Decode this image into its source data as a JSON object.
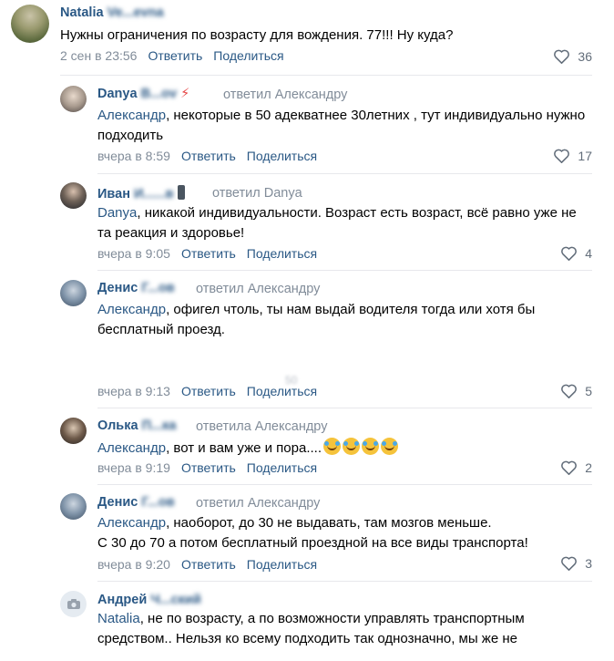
{
  "comments": [
    {
      "name": "Natalia",
      "name_rest": "Ve...evna",
      "text": "Нужны ограничения по возрасту для вождения. 77!!! Ну куда?",
      "time": "2 сен в 23:56",
      "reply_label": "Ответить",
      "share_label": "Поделиться",
      "likes": "36"
    },
    {
      "name": "Danya",
      "name_rest": "B...ov",
      "badge": "⚡",
      "replied": "ответил Александру",
      "mention": "Александр",
      "text": ", некоторые в 50 адекватнее 30летних , тут индивидуально нужно подходить",
      "time": "вчера в 8:59",
      "reply_label": "Ответить",
      "share_label": "Поделиться",
      "likes": "17"
    },
    {
      "name": "Иван",
      "name_rest": "И......в",
      "replied": "ответил Danya",
      "mention": "Danya",
      "text": ", никакой индивидуальности. Возраст есть возраст, всё равно уже не та реакция и здоровье!",
      "time": "вчера в 9:05",
      "reply_label": "Ответить",
      "share_label": "Поделиться",
      "likes": "4"
    },
    {
      "name": "Денис",
      "name_rest": "Г...ов",
      "replied": "ответил Александру",
      "mention": "Александр",
      "text": ", офигел чтоль, ты нам выдай водителя тогда или хотя бы бесплатный проезд.",
      "time": "вчера в 9:13",
      "reply_label": "Ответить",
      "share_label": "Поделиться",
      "likes": "5"
    },
    {
      "name": "Олька",
      "name_rest": "П...ка",
      "replied": "ответила Александру",
      "mention": "Александр",
      "text": ", вот и вам уже и пора....",
      "time": "вчера в 9:19",
      "reply_label": "Ответить",
      "share_label": "Поделиться",
      "likes": "2"
    },
    {
      "name": "Денис",
      "name_rest": "Г...ов",
      "replied": "ответил Александру",
      "mention": "Александр",
      "text": ", наоборот, до 30 не выдавать, там мозгов меньше.",
      "text2": "С 30 до 70 а потом бесплатный проездной на все виды транспорта!",
      "time": "вчера в 9:20",
      "reply_label": "Ответить",
      "share_label": "Поделиться",
      "likes": "3"
    },
    {
      "name": "Андрей",
      "name_rest": "Ч...ский",
      "mention": "Natalia",
      "text": ", не по возрасту, а по возможности управлять транспортным средством.. Нельзя ко всему подходить так однозначно, мы же не"
    }
  ],
  "ghost_text": "50",
  "colors": {
    "link": "#2a5885",
    "meta": "#818c99",
    "separator": "#e7e8ec"
  }
}
